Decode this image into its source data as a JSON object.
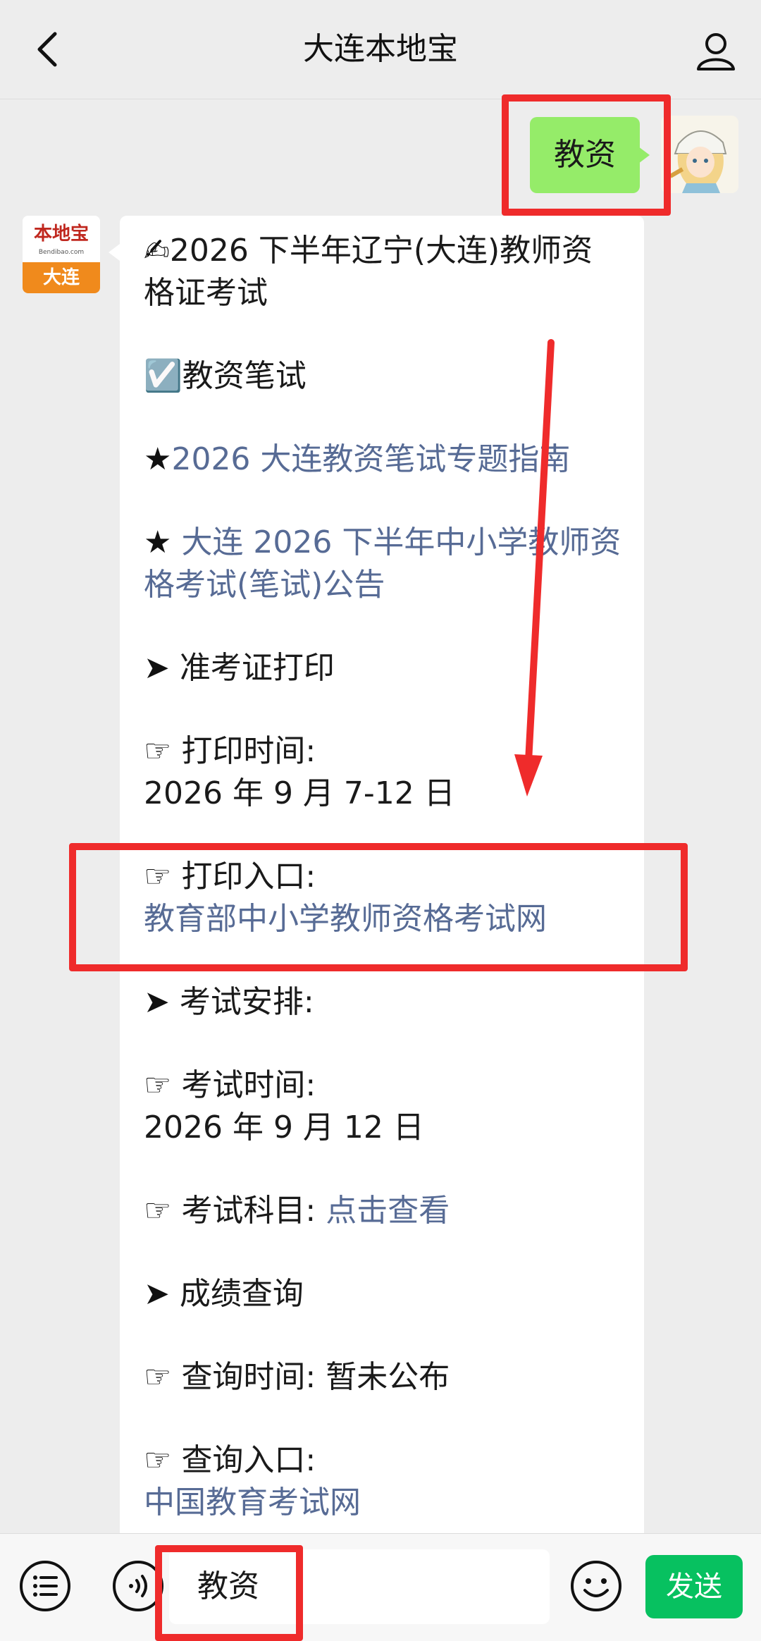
{
  "header": {
    "title": "大连本地宝",
    "back_icon": "chevron-left-icon",
    "user_icon": "user-icon"
  },
  "outgoing": {
    "text": "教资"
  },
  "incoming": {
    "avatar": {
      "logo_text": "本地宝",
      "logo_sub": "Bendibao.com",
      "city": "大连"
    },
    "blocks": [
      {
        "prefix": "✍",
        "text": "2026 下半年辽宁(大连)教师资格证考试"
      },
      {
        "prefix": "☑️",
        "text": "教资笔试"
      },
      {
        "prefix": "★",
        "link": "2026 大连教资笔试专题指南"
      },
      {
        "prefix": "★ ",
        "link": "大连 2026 下半年中小学教师资格考试(笔试)公告"
      },
      {
        "prefix": "➤ ",
        "text": "准考证打印"
      },
      {
        "prefix": "☞ ",
        "text": "打印时间:",
        "line2": "2026 年 9 月 7-12 日"
      },
      {
        "prefix": "☞ ",
        "text": "打印入口:",
        "link2": "教育部中小学教师资格考试网"
      },
      {
        "prefix": "➤ ",
        "text": "考试安排:"
      },
      {
        "prefix": "☞ ",
        "text": "考试时间:",
        "line2": "2026 年 9 月 12 日"
      },
      {
        "prefix": "☞ ",
        "text": "考试科目: ",
        "link": "点击查看"
      },
      {
        "prefix": "➤ ",
        "text": "成绩查询"
      },
      {
        "prefix": "☞ ",
        "text": "查询时间: 暂未公布"
      },
      {
        "prefix": "☞ ",
        "text": "查询入口:",
        "link2": "中国教育考试网"
      }
    ]
  },
  "inputbar": {
    "menu_icon": "list-menu-icon",
    "voice_icon": "voice-icon",
    "input_value": "教资",
    "emoji_icon": "emoji-icon",
    "send_label": "发送"
  },
  "colors": {
    "background": "#ededed",
    "outgoing_bubble": "#95ec69",
    "link": "#576b95",
    "send_button": "#07c160",
    "highlight": "#ef2b2b"
  }
}
